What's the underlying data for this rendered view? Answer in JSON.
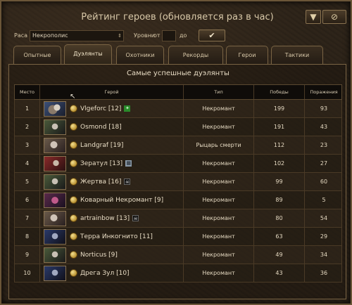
{
  "window": {
    "title": "Рейтинг героев (обновляется раз в час)"
  },
  "icons": {
    "filter": "filter-icon",
    "cancel": "cancel-icon",
    "confirm": "checkmark-icon"
  },
  "filters": {
    "race_label": "Раса",
    "race_value": "Некрополис",
    "levels_label": "Уровни",
    "from_label": "от",
    "to_label": "до",
    "from_value": "",
    "to_value": ""
  },
  "tabs": [
    {
      "label": "Опытные",
      "active": false
    },
    {
      "label": "Дуэлянты",
      "active": true
    },
    {
      "label": "Охотники",
      "active": false
    },
    {
      "label": "Рекорды",
      "active": false
    },
    {
      "label": "Герои",
      "active": false
    },
    {
      "label": "Тактики",
      "active": false
    }
  ],
  "panel": {
    "title": "Самые успешные дуэлянты"
  },
  "table": {
    "headers": [
      "Место",
      "Герой",
      "Тип",
      "Победы",
      "Поражения"
    ],
    "rows": [
      {
        "place": "1",
        "hero": "Vlgeforc [12]",
        "guild": "green",
        "type": "Некромант",
        "wins": "199",
        "losses": "93"
      },
      {
        "place": "2",
        "hero": "Osmond [18]",
        "guild": "",
        "type": "Некромант",
        "wins": "191",
        "losses": "43"
      },
      {
        "place": "3",
        "hero": "Landgraf [19]",
        "guild": "",
        "type": "Рыцарь смерти",
        "wins": "112",
        "losses": "23"
      },
      {
        "place": "4",
        "hero": "Зератул [13]",
        "guild": "grey",
        "type": "Некромант",
        "wins": "102",
        "losses": "27"
      },
      {
        "place": "5",
        "hero": "Жертва [16]",
        "guild": "skull",
        "type": "Некромант",
        "wins": "99",
        "losses": "60"
      },
      {
        "place": "6",
        "hero": "Коварный Некромант [9]",
        "guild": "",
        "type": "Некромант",
        "wins": "89",
        "losses": "5"
      },
      {
        "place": "7",
        "hero": "artrainbow [13]",
        "guild": "skull",
        "type": "Некромант",
        "wins": "80",
        "losses": "54"
      },
      {
        "place": "8",
        "hero": "Терра Инкогнито [11]",
        "guild": "",
        "type": "Некромант",
        "wins": "63",
        "losses": "29"
      },
      {
        "place": "9",
        "hero": "Norticus [9]",
        "guild": "",
        "type": "Некромант",
        "wins": "49",
        "losses": "34"
      },
      {
        "place": "10",
        "hero": "Дрега Зул [10]",
        "guild": "",
        "type": "Некромант",
        "wins": "43",
        "losses": "36"
      }
    ]
  }
}
